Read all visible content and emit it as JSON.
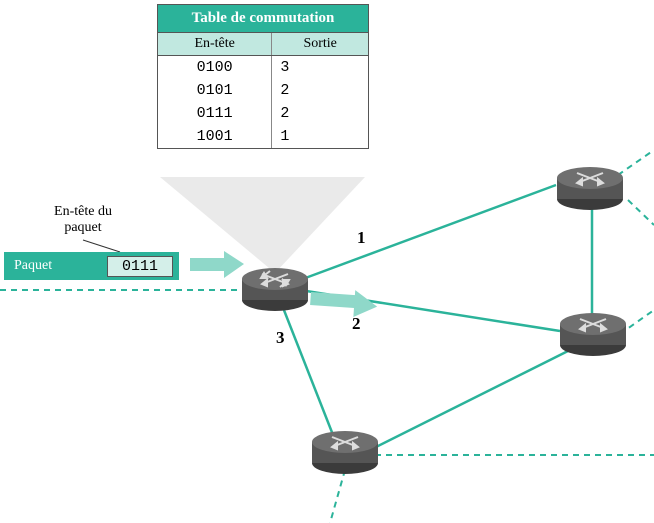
{
  "table": {
    "title": "Table de commutation",
    "header_col1": "En-tête",
    "header_col2": "Sortie",
    "rows": [
      {
        "header": "0100",
        "output": "3"
      },
      {
        "header": "0101",
        "output": "2"
      },
      {
        "header": "0111",
        "output": "2"
      },
      {
        "header": "1001",
        "output": "1"
      }
    ]
  },
  "packet": {
    "caption_line1": "En-tête du",
    "caption_line2": "paquet",
    "box_label": "Paquet",
    "header_value": "0111"
  },
  "ports": {
    "p1": "1",
    "p2": "2",
    "p3": "3"
  },
  "colors": {
    "teal": "#2bb39a",
    "teal_light": "#8fd8c9"
  }
}
